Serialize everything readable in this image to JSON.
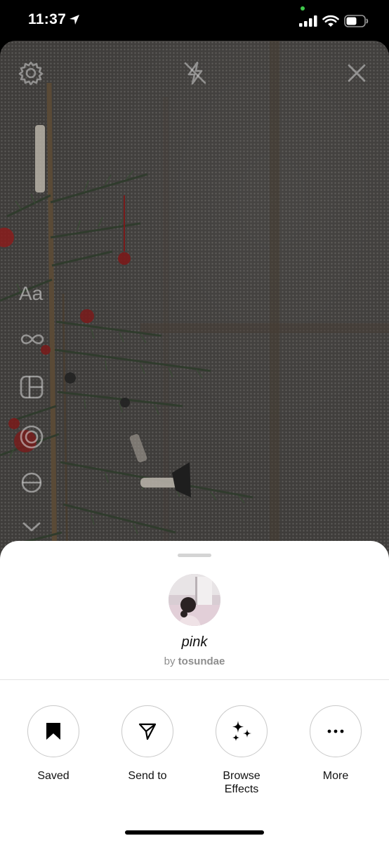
{
  "status_bar": {
    "time": "11:37",
    "icons": [
      "location-arrow-icon",
      "signal-icon",
      "wifi-icon",
      "battery-icon"
    ]
  },
  "camera": {
    "top_controls": [
      "settings-icon",
      "flash-off-icon",
      "close-icon"
    ],
    "left_tools": {
      "text_tool_label": "Aa",
      "icons": [
        "boomerang-icon",
        "layout-icon",
        "multi-capture-icon",
        "level-icon",
        "chevron-down-icon"
      ]
    }
  },
  "sheet": {
    "effect_name": "pink",
    "by_prefix": "by",
    "creator": "tosundae",
    "actions": [
      {
        "label": "Saved",
        "icon": "bookmark-icon"
      },
      {
        "label": "Send to",
        "icon": "send-icon"
      },
      {
        "label": "Browse\nEffects",
        "icon": "sparkles-icon"
      },
      {
        "label": "More",
        "icon": "more-icon"
      }
    ]
  },
  "colors": {
    "sheet_background": "#ffffff",
    "camera_overlay": "#3f3d3b",
    "status_bar": "#000000",
    "camera_indicator": "#3ec84a"
  }
}
